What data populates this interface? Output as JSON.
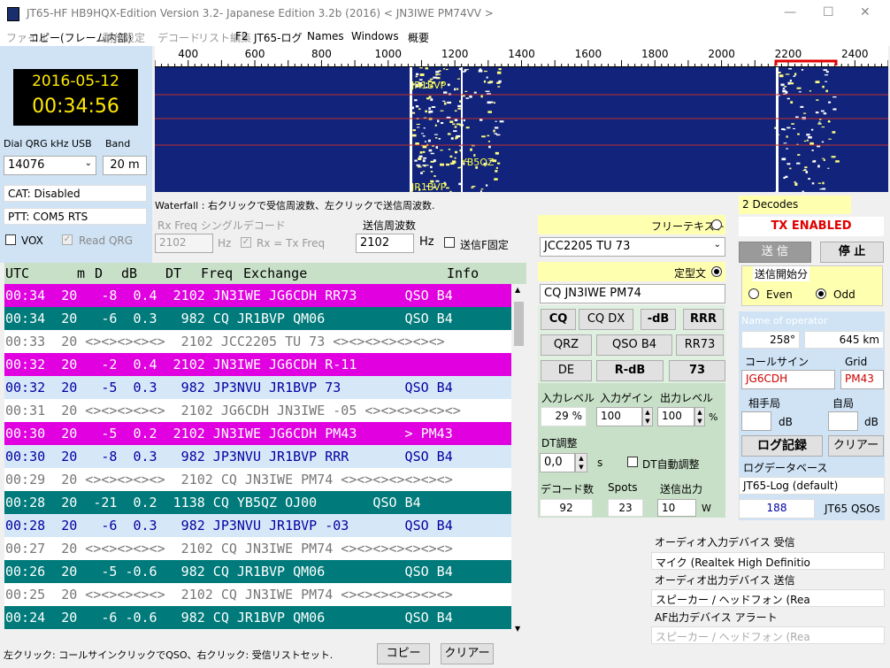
{
  "window": {
    "title": "JT65-HF HB9HQX-Edition Version 3.2- Japanese Edition 3.2b (2016)   < JN3IWE PM74VV >"
  },
  "menu": [
    {
      "label": "ファイル",
      "dim": true
    },
    {
      "label": "コピー(フレーム内部)",
      "dim": false
    },
    {
      "label": "動作設定",
      "dim": true
    },
    {
      "label": "デコード",
      "dim": true
    },
    {
      "label": "リスト編集",
      "dim": true
    },
    {
      "label": "F2",
      "dim": false
    },
    {
      "label": "JT65-ログ",
      "dim": false
    },
    {
      "label": "Names",
      "dim": false
    },
    {
      "label": "Windows",
      "dim": false
    },
    {
      "label": "概要",
      "dim": false
    }
  ],
  "clock": {
    "date": "2016-05-12",
    "time": "00:34:56"
  },
  "dial": {
    "label": "Dial QRG kHz USB",
    "value": "14076",
    "band_label": "Band",
    "band": "20 m"
  },
  "cat": "CAT: Disabled",
  "ptt": "PTT: COM5 RTS",
  "vox": "VOX",
  "read_qrg": "Read QRG",
  "ruler": {
    "ticks": [
      "400",
      "600",
      "800",
      "1000",
      "1200",
      "1400",
      "1600",
      "1800",
      "2000",
      "2200",
      "2400"
    ]
  },
  "waterfall": {
    "labels": [
      "JR1BVP",
      "YB5QZ",
      "JR1BVP"
    ],
    "hint": "Waterfall : 右クリックで受信周波数、左クリックで送信周波数."
  },
  "rx": {
    "label": "Rx Freq シングルデコード",
    "value": "2102",
    "unit": "Hz",
    "eq": "Rx = Tx Freq"
  },
  "tx": {
    "label": "送信周波数",
    "value": "2102",
    "unit": "Hz",
    "fixed": "送信F固定"
  },
  "table": {
    "headers": {
      "utc": "UTC",
      "m": "m",
      "d": "D",
      "db": "dB",
      "dt": "DT",
      "freq": "Freq",
      "exchange": "Exchange",
      "info": "Info"
    },
    "rows": [
      {
        "text": "00:34  20   -8  0.4  2102 JN3IWE JG6CDH RR73      QSO B4",
        "bg": "#e000e0",
        "fg": "#ffffff"
      },
      {
        "text": "00:34  20   -6  0.3   982 CQ JR1BVP QM06          QSO B4",
        "bg": "#007a7a",
        "fg": "#ffffff"
      },
      {
        "text": "00:33  20 <><><><><>  2102 JCC2205 TU 73 <><><><><><><>",
        "bg": "#ffffff",
        "fg": "#777777"
      },
      {
        "text": "00:32  20   -2  0.4  2102 JN3IWE JG6CDH R-11",
        "bg": "#e000e0",
        "fg": "#ffffff"
      },
      {
        "text": "00:32  20   -5  0.3   982 JP3NVU JR1BVP 73        QSO B4",
        "bg": "#d6e8f8",
        "fg": "#0000a0"
      },
      {
        "text": "00:31  20 <><><><><>  2102 JG6CDH JN3IWE -05 <><><><><><>",
        "bg": "#ffffff",
        "fg": "#777777"
      },
      {
        "text": "00:30  20   -5  0.2  2102 JN3IWE JG6CDH PM43      > PM43",
        "bg": "#e000e0",
        "fg": "#ffffff"
      },
      {
        "text": "00:30  20   -8  0.3   982 JP3NVU JR1BVP RRR       QSO B4",
        "bg": "#d6e8f8",
        "fg": "#0000a0"
      },
      {
        "text": "00:29  20 <><><><><>  2102 CQ JN3IWE PM74 <><><><><><><>",
        "bg": "#ffffff",
        "fg": "#777777"
      },
      {
        "text": "00:28  20  -21  0.2  1138 CQ YB5QZ OJ00       QSO B4",
        "bg": "#007a7a",
        "fg": "#ffffff"
      },
      {
        "text": "00:28  20   -6  0.3   982 JP3NVU JR1BVP -03       QSO B4",
        "bg": "#d6e8f8",
        "fg": "#0000a0"
      },
      {
        "text": "00:27  20 <><><><><>  2102 CQ JN3IWE PM74 <><><><><><><>",
        "bg": "#ffffff",
        "fg": "#777777"
      },
      {
        "text": "00:26  20   -5 -0.6   982 CQ JR1BVP QM06          QSO B4",
        "bg": "#007a7a",
        "fg": "#ffffff"
      },
      {
        "text": "00:25  20 <><><><><>  2102 CQ JN3IWE PM74 <><><><><><><>",
        "bg": "#ffffff",
        "fg": "#777777"
      },
      {
        "text": "00:24  20   -6 -0.6   982 CQ JR1BVP QM06          QSO B4",
        "bg": "#007a7a",
        "fg": "#ffffff"
      }
    ]
  },
  "bottom": {
    "hint": "左クリック: コールサインクリックでQSO、右クリック: 受信リストセット.",
    "copy": "コピー",
    "clear": "クリアー"
  },
  "msg": {
    "free_label": "フリーテキスト",
    "free_value": "JCC2205  TU 73",
    "fixed_label": "定型文",
    "fixed_value": "CQ  JN3IWE PM74"
  },
  "macros": [
    [
      "CQ",
      "CQ DX",
      "-dB",
      "RRR"
    ],
    [
      "QRZ",
      "QSO B4",
      "RR73"
    ],
    [
      "DE",
      "R-dB",
      "73"
    ]
  ],
  "levels": {
    "in_label": "入力レベル",
    "in": "29 %",
    "gain_label": "入力ゲイン",
    "gain": "100",
    "out_label": "出力レベル",
    "out": "100",
    "pct": "%"
  },
  "dt": {
    "label": "DT調整",
    "value": "0,0",
    "unit": "s",
    "auto": "DT自動調整"
  },
  "stats": {
    "decodes_label": "デコード数",
    "decodes": "92",
    "spots_label": "Spots",
    "spots": "23",
    "txpwr_label": "送信出力",
    "txpwr": "10",
    "w": "W"
  },
  "status": {
    "decodes": "2 Decodes",
    "tx": "TX ENABLED",
    "send": "送 信",
    "stop": "停 止",
    "start_label": "送信開始分",
    "even": "Even",
    "odd": "Odd"
  },
  "op": {
    "name_label": "Name of operator",
    "az": "258°",
    "km": "645 km",
    "call_label": "コールサイン",
    "call": "JG6CDH",
    "grid_label": "Grid",
    "grid": "PM43",
    "his_label": "相手局",
    "my_label": "自局",
    "db": "dB",
    "log": "ログ記録",
    "clear": "クリアー",
    "db_label": "ログデータベース",
    "db_value": "JT65-Log (default)",
    "qsos": "188",
    "qsos_label": "JT65 QSOs"
  },
  "audio": {
    "in_label": "オーディオ入力デバイス 受信",
    "in": "マイク (Realtek High Definitio",
    "out_label": "オーディオ出力デバイス 送信",
    "out": "スピーカー / ヘッドフォン (Rea",
    "af_label": "AF出力デバイス アラート",
    "af": "スピーカー / ヘッドフォン (Rea"
  }
}
